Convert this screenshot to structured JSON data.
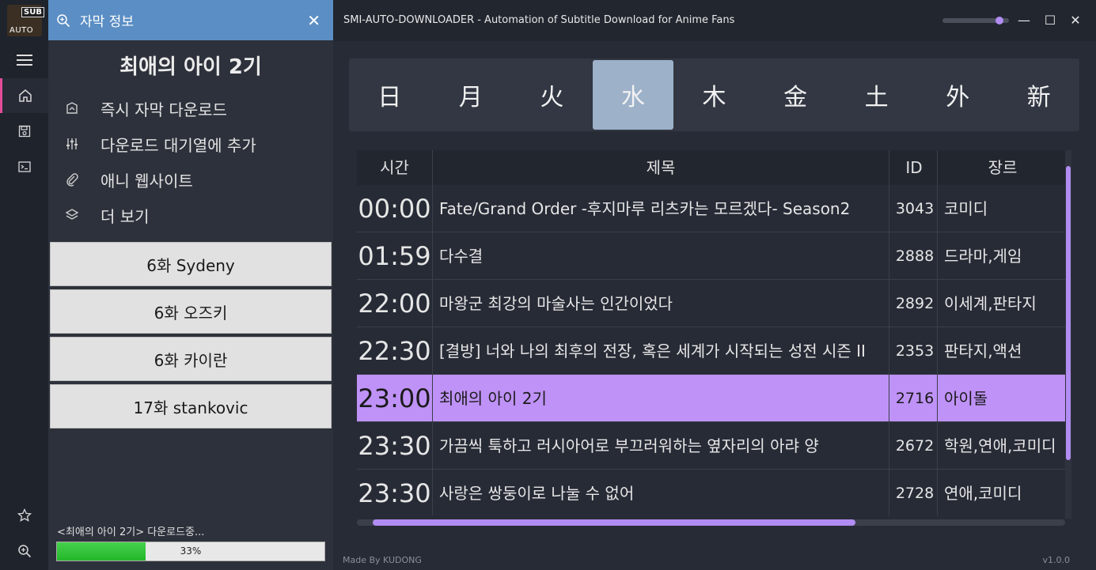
{
  "rail": {
    "logo_badge": "SUB",
    "logo_text": "AUTO",
    "items": [
      {
        "icon": "menu-icon"
      },
      {
        "icon": "home-icon",
        "active": true
      },
      {
        "icon": "save-icon"
      },
      {
        "icon": "terminal-icon"
      },
      {
        "icon": "star-icon"
      },
      {
        "icon": "zoom-icon"
      }
    ]
  },
  "panel": {
    "search_label": "자막 정보",
    "title": "최애의 아이 2기",
    "menu": [
      {
        "icon": "download-chart-icon",
        "label": "즉시 자막 다운로드"
      },
      {
        "icon": "sliders-icon",
        "label": "다운로드 대기열에 추가"
      },
      {
        "icon": "paperclip-icon",
        "label": "애니 웹사이트"
      },
      {
        "icon": "layers-icon",
        "label": "더 보기"
      }
    ],
    "episodes": [
      "6화 Sydeny",
      "6화 오즈키",
      "6화 카이란",
      "17화 stankovic"
    ],
    "download_status": "<최애의 아이 2기> 다운로드중...",
    "progress_percent": 33,
    "progress_label": "33%"
  },
  "titlebar": {
    "title": "SMI-AUTO-DOWNLOADER - Automation of Subtitle Download for Anime Fans",
    "slider_value": 0.9,
    "min_icon": "—",
    "max_icon": "☐",
    "close_icon": "✕"
  },
  "days": [
    "日",
    "月",
    "火",
    "水",
    "木",
    "金",
    "土",
    "外",
    "新"
  ],
  "selected_day": 3,
  "table": {
    "headers": {
      "time": "시간",
      "title": "제목",
      "id": "ID",
      "genre": "장르"
    },
    "rows": [
      {
        "time": "00:00",
        "title": "Fate/Grand Order -후지마루 리츠카는 모르겠다- Season2",
        "id": "3043",
        "genre": "코미디"
      },
      {
        "time": "01:59",
        "title": "다수결",
        "id": "2888",
        "genre": "드라마,게임"
      },
      {
        "time": "22:00",
        "title": "마왕군 최강의 마술사는 인간이었다",
        "id": "2892",
        "genre": "이세계,판타지"
      },
      {
        "time": "22:30",
        "title": "[결방] 너와 나의 최후의 전장, 혹은 세계가 시작되는 성전 시즌 II",
        "id": "2353",
        "genre": "판타지,액션"
      },
      {
        "time": "23:00",
        "title": "최애의 아이 2기",
        "id": "2716",
        "genre": "아이돌",
        "selected": true
      },
      {
        "time": "23:30",
        "title": "가끔씩 툭하고 러시아어로 부끄러워하는 옆자리의 아랴 양",
        "id": "2672",
        "genre": "학원,연애,코미디"
      },
      {
        "time": "23:30",
        "title": "사랑은 쌍둥이로 나눌 수 없어",
        "id": "2728",
        "genre": "연애,코미디"
      }
    ]
  },
  "footer": {
    "credit": "Made By KUDONG",
    "version": "v1.0.0"
  },
  "colors": {
    "accent": "#bf92f7",
    "search_bar": "#5b8ec4",
    "rail_active": "#e34c9a",
    "day_selected": "#9db1c9"
  }
}
